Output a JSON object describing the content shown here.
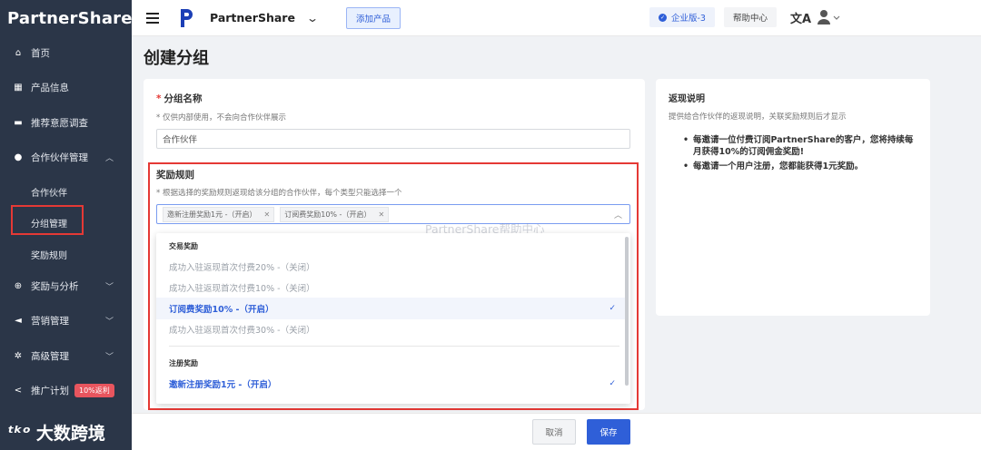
{
  "app": {
    "logo_text": "PartnerShare",
    "brand_name": "PartnerShare",
    "add_product_label": "添加产品",
    "edition_label": "企业版-3",
    "help_label": "帮助中心",
    "lang_glyph": "文A"
  },
  "sidebar": {
    "items": [
      {
        "label": "首页",
        "icon": "home-icon"
      },
      {
        "label": "产品信息",
        "icon": "grid-icon"
      },
      {
        "label": "推荐意愿调查",
        "icon": "chat-icon"
      },
      {
        "label": "合作伙伴管理",
        "icon": "user-icon"
      },
      {
        "label": "奖励与分析",
        "icon": "plus-circle-icon"
      },
      {
        "label": "营销管理",
        "icon": "megaphone-icon"
      },
      {
        "label": "高级管理",
        "icon": "gear-icon"
      },
      {
        "label": "推广计划",
        "icon": "share-icon",
        "badge": "10%返利"
      }
    ],
    "sub_items": [
      {
        "label": "合作伙伴"
      },
      {
        "label": "分组管理"
      },
      {
        "label": "奖励规则"
      }
    ],
    "watermark_brand": "大数跨境",
    "watermark_mark": "ᵗᵏᵒ"
  },
  "page": {
    "title": "创建分组",
    "group_name_label": "分组名称",
    "group_name_hint": "* 仅供内部使用，不会向合作伙伴展示",
    "group_name_value": "合作伙伴",
    "rules_label": "奖励规则",
    "rules_hint": "* 根据选择的奖励规则返现给该分组的合作伙伴，每个类型只能选择一个",
    "selected_tags": [
      "邀新注册奖励1元 -（开启）",
      "订阅费奖励10% -（开启）"
    ],
    "overlay_watermark": "PartnerShare帮助中心"
  },
  "dropdown": {
    "group1_title": "交易奖励",
    "group1_options": [
      {
        "label": "成功入驻返现首次付费20% -（关闭）",
        "selected": false
      },
      {
        "label": "成功入驻返现首次付费10% -（关闭）",
        "selected": false
      },
      {
        "label": "订阅费奖励10% -（开启）",
        "selected": true
      },
      {
        "label": "成功入驻返现首次付费30% -（关闭）",
        "selected": false
      }
    ],
    "group2_title": "注册奖励",
    "group2_options": [
      {
        "label": "邀新注册奖励1元 -（开启）",
        "selected": true
      }
    ]
  },
  "right_panel": {
    "title": "返现说明",
    "subtitle": "提供给合作伙伴的返现说明，关联奖励规则后才显示",
    "bullets": [
      "每邀请一位付费订阅PartnerShare的客户，您将持续每月获得10%的订阅佣金奖励!",
      "每邀请一个用户注册，您都能获得1元奖励。"
    ]
  },
  "footer": {
    "cancel_label": "取消",
    "save_label": "保存"
  }
}
